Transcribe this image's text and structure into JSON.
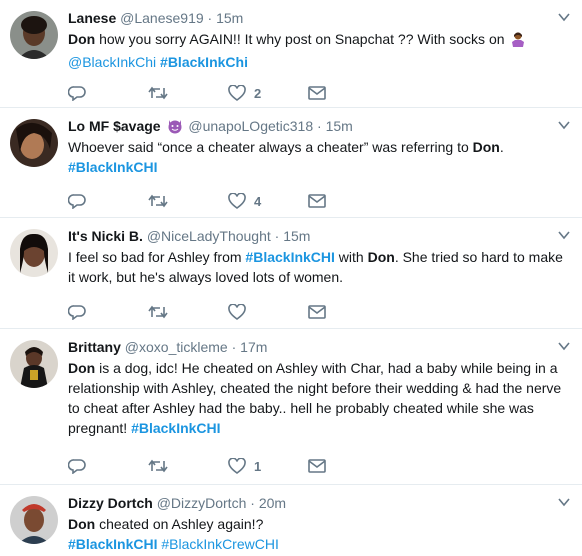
{
  "tweets": [
    {
      "name": "Lanese",
      "handle": "@Lanese919",
      "time": "15m",
      "emoji": "woman-shrugging-emoji",
      "segments": [
        {
          "t": "b",
          "v": "Don"
        },
        {
          "t": "n",
          "v": " how you sorry AGAIN!!  It why post on Snapchat ?? With socks on "
        }
      ],
      "segments_after_emoji": [
        {
          "t": "link",
          "v": "@BlackInkChi"
        },
        {
          "t": "n",
          "v": " "
        },
        {
          "t": "tag",
          "v": "#BlackInkChi"
        }
      ],
      "likes": "2"
    },
    {
      "name": "Lo MF $avage",
      "name_emoji": "purple-devil-emoji",
      "handle": "@unapoLOgetic318",
      "time": "15m",
      "segments": [
        {
          "t": "n",
          "v": "Whoever said “once a cheater always a cheater” was referring to "
        },
        {
          "t": "b",
          "v": "Don"
        },
        {
          "t": "n",
          "v": ". "
        },
        {
          "t": "tag",
          "v": "#BlackInkCHI"
        }
      ],
      "likes": "4"
    },
    {
      "name": "It's Nicki B.",
      "handle": "@NiceLadyThought",
      "time": "15m",
      "segments": [
        {
          "t": "n",
          "v": "I feel so bad for Ashley from "
        },
        {
          "t": "tag",
          "v": "#BlackInkCHI"
        },
        {
          "t": "n",
          "v": " with "
        },
        {
          "t": "b",
          "v": "Don"
        },
        {
          "t": "n",
          "v": ". She tried so hard to make it work, but he's always loved lots of women."
        }
      ],
      "likes": ""
    },
    {
      "name": "Brittany",
      "handle": "@xoxo_tickleme",
      "time": "17m",
      "segments": [
        {
          "t": "b",
          "v": "Don"
        },
        {
          "t": "n",
          "v": " is a dog, idc! He cheated on Ashley with Char, had a baby while being in a relationship with Ashley, cheated the night before their wedding & had the nerve to cheat after Ashley had the baby.. hell he probably cheated while she was pregnant!  "
        },
        {
          "t": "tag",
          "v": "#BlackInkCHI"
        }
      ],
      "likes": "1"
    },
    {
      "name": "Dizzy Dortch",
      "handle": "@DizzyDortch",
      "time": "20m",
      "segments": [
        {
          "t": "b",
          "v": "Don"
        },
        {
          "t": "n",
          "v": " cheated on Ashley again!? "
        },
        {
          "t": "tag",
          "v": "#BlackInkCHI"
        },
        {
          "t": "n",
          "v": " "
        },
        {
          "t": "link",
          "v": "#BlackInkCrewCHI"
        }
      ],
      "likes": ""
    }
  ],
  "icons": {
    "reply": "reply-icon",
    "retweet": "retweet-icon",
    "like": "heart-icon",
    "dm": "envelope-icon",
    "menu": "chevron-down-icon"
  },
  "colors": {
    "link": "#1b95e0",
    "muted": "#657786",
    "text": "#14171a",
    "divider": "#e6ecf0"
  }
}
